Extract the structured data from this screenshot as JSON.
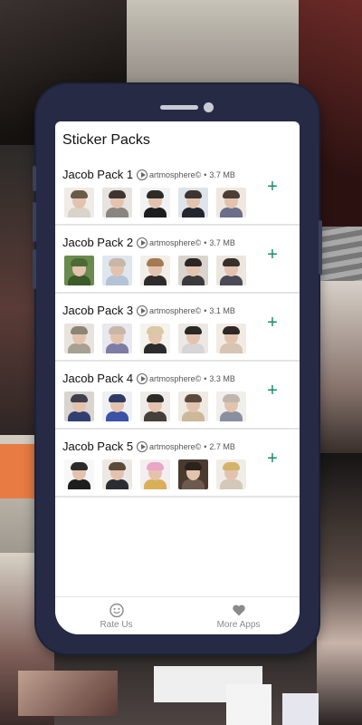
{
  "app": {
    "title": "Sticker Packs"
  },
  "packs": [
    {
      "name": "Jacob Pack 1",
      "author": "artmosphere©",
      "size": "3.7 MB",
      "stickers": [
        {
          "bg": "#f0ebe6",
          "hair": "#6b5a48",
          "body": "#d9d3cc"
        },
        {
          "bg": "#e6e3e0",
          "hair": "#3e3530",
          "body": "#8a8580"
        },
        {
          "bg": "#f2f2f2",
          "hair": "#2d2a2a",
          "body": "#1d1d1f"
        },
        {
          "bg": "#dfe4ea",
          "hair": "#3b3430",
          "body": "#23262f"
        },
        {
          "bg": "#efe7e0",
          "hair": "#4a3e36",
          "body": "#6c6f8a"
        }
      ]
    },
    {
      "name": "Jacob Pack 2",
      "author": "artmosphere©",
      "size": "3.7 MB",
      "stickers": [
        {
          "bg": "#6a8a4e",
          "hair": "#4a6b35",
          "body": "#3d5a2b"
        },
        {
          "bg": "#dfe6ee",
          "hair": "#c8b7a6",
          "body": "#b4c3d6"
        },
        {
          "bg": "#f3efe8",
          "hair": "#a47a54",
          "body": "#2d2b2b"
        },
        {
          "bg": "#d9d4ce",
          "hair": "#2a2626",
          "body": "#3a3a3d"
        },
        {
          "bg": "#ece6df",
          "hair": "#38302b",
          "body": "#4b4b55"
        }
      ]
    },
    {
      "name": "Jacob Pack 3",
      "author": "artmosphere©",
      "size": "3.1 MB",
      "stickers": [
        {
          "bg": "#e8e4dd",
          "hair": "#8c8576",
          "body": "#a8a092"
        },
        {
          "bg": "#e9e7f0",
          "hair": "#c7b7a8",
          "body": "#7d7ca4"
        },
        {
          "bg": "#f5f3ee",
          "hair": "#d8c8a4",
          "body": "#2b2b2b"
        },
        {
          "bg": "#ece9e5",
          "hair": "#2a2727",
          "body": "#d6d6d6"
        },
        {
          "bg": "#f1ebe4",
          "hair": "#2e2725",
          "body": "#d7c4b5"
        }
      ]
    },
    {
      "name": "Jacob Pack 4",
      "author": "artmosphere©",
      "size": "3.3 MB",
      "stickers": [
        {
          "bg": "#d9d4ce",
          "hair": "#40404a",
          "body": "#324070"
        },
        {
          "bg": "#eef0f3",
          "hair": "#2f3a66",
          "body": "#3a52a8"
        },
        {
          "bg": "#f0ebe6",
          "hair": "#2d2929",
          "body": "#45403c"
        },
        {
          "bg": "#efeae3",
          "hair": "#5b4a3c",
          "body": "#ccb89a"
        },
        {
          "bg": "#f1efeb",
          "hair": "#bfb7ae",
          "body": "#8a8fa0"
        }
      ]
    },
    {
      "name": "Jacob Pack 5",
      "author": "artmosphere©",
      "size": "2.7 MB",
      "stickers": [
        {
          "bg": "#f7f7f7",
          "hair": "#2b2b2b",
          "body": "#1d1d1d"
        },
        {
          "bg": "#ece8e3",
          "hair": "#5b4a3a",
          "body": "#2c2d33"
        },
        {
          "bg": "#f4eef0",
          "hair": "#e9a6c6",
          "body": "#d9b05a"
        },
        {
          "bg": "#4a3a30",
          "hair": "#2b221c",
          "body": "#6b5a4d"
        },
        {
          "bg": "#f0ede8",
          "hair": "#d4b46a",
          "body": "#d4c8b8"
        }
      ]
    }
  ],
  "nav": {
    "rate_icon": "smiley-icon",
    "rate_label": "Rate Us",
    "more_icon": "heart-icon",
    "more_label": "More Apps"
  },
  "colors": {
    "accent": "#1c8a6a",
    "frame": "#262a45"
  }
}
